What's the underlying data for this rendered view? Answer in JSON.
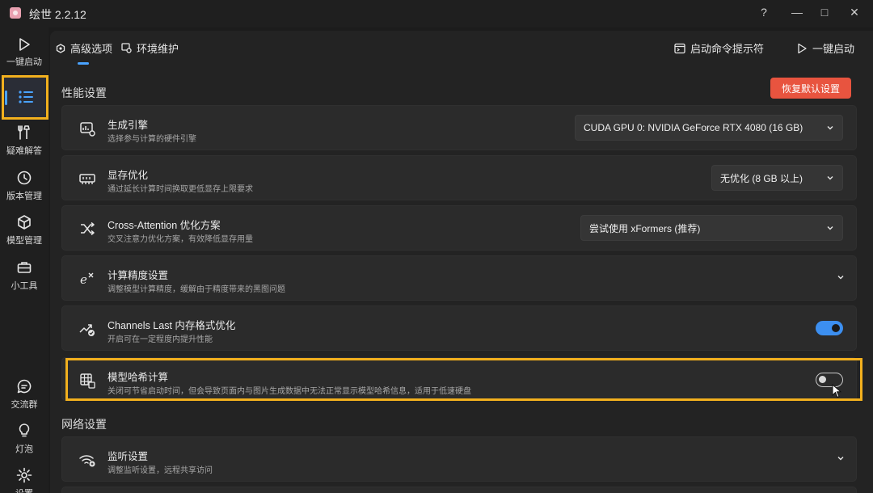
{
  "window": {
    "title": "绘世 2.2.12",
    "controls": [
      "?",
      "—",
      "□",
      "✕"
    ]
  },
  "rail": {
    "items": [
      {
        "label": "一键启动",
        "icon": "play-icon"
      },
      {
        "label": "",
        "icon": "list-settings-icon",
        "active": true
      },
      {
        "label": "疑难解答",
        "icon": "tools-icon"
      },
      {
        "label": "版本管理",
        "icon": "history-icon"
      },
      {
        "label": "模型管理",
        "icon": "cube-icon"
      },
      {
        "label": "小工具",
        "icon": "toolbox-icon"
      },
      {
        "label": "交流群",
        "icon": "chat-icon"
      },
      {
        "label": "灯泡",
        "icon": "bulb-icon"
      },
      {
        "label": "设置",
        "icon": "gear-icon"
      }
    ]
  },
  "tabs": {
    "advanced": "高级选项",
    "env": "环境维护",
    "cmd": "启动命令提示符",
    "launch": "一键启动"
  },
  "sections": {
    "performance": "性能设置",
    "network": "网络设置"
  },
  "reset_button": "恢复默认设置",
  "settings": [
    {
      "title": "生成引擎",
      "desc": "选择参与计算的硬件引擎",
      "control": "select",
      "value": "CUDA GPU 0: NVIDIA GeForce RTX 4080 (16 GB)",
      "icon": "chip-engine-icon"
    },
    {
      "title": "显存优化",
      "desc": "通过延长计算时间换取更低显存上限要求",
      "control": "select",
      "value": "无优化 (8 GB 以上)",
      "icon": "memory-icon"
    },
    {
      "title": "Cross-Attention 优化方案",
      "desc": "交叉注意力优化方案，有效降低显存用量",
      "control": "select",
      "value": "尝试使用 xFormers (推荐)",
      "icon": "shuffle-icon"
    },
    {
      "title": "计算精度设置",
      "desc": "调整模型计算精度，缓解由于精度带来的黑图问题",
      "control": "expand",
      "icon": "exponent-icon"
    },
    {
      "title": "Channels Last 内存格式优化",
      "desc": "开启可在一定程度内提升性能",
      "control": "toggle",
      "on": true,
      "icon": "trend-check-icon"
    },
    {
      "title": "模型哈希计算",
      "desc": "关闭可节省启动时间，但会导致页面内与图片生成数据中无法正常显示模型哈希信息，适用于低速硬盘",
      "control": "toggle",
      "on": false,
      "icon": "grid-hash-icon"
    },
    {
      "title": "监听设置",
      "desc": "调整监听设置，远程共享访问",
      "control": "expand",
      "icon": "wifi-share-icon"
    }
  ],
  "colors": {
    "accent": "#3c8ff0",
    "reset": "#e8543f",
    "highlight": "#f2b01e"
  }
}
